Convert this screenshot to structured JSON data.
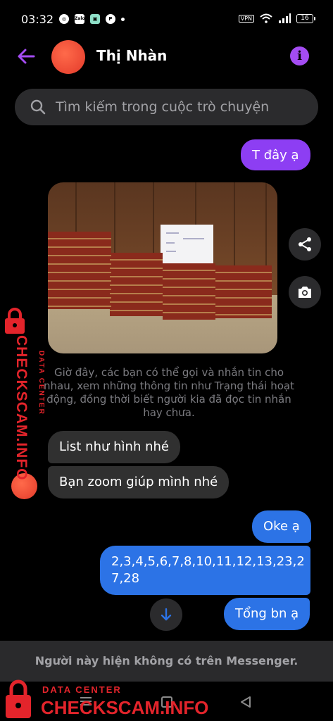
{
  "status": {
    "time": "03:32",
    "apps": [
      "chrome",
      "Zalo",
      "app",
      "pinterest"
    ],
    "vpn": "VPN",
    "battery": "16"
  },
  "header": {
    "contact_name": "Thị Nhàn",
    "info_symbol": "i"
  },
  "search": {
    "placeholder": "Tìm kiếm trong cuộc trò chuyện"
  },
  "messages": [
    {
      "side": "out",
      "text": "T đây ạ"
    },
    {
      "side": "in",
      "type": "photo"
    },
    {
      "side": "system",
      "text": "Giờ đây, các bạn có thể gọi và nhắn tin cho nhau, xem những thông tin như Trạng thái hoạt động, đồng thời biết người kia đã đọc tin nhắn hay chưa."
    },
    {
      "side": "in",
      "text": "List như hình nhé"
    },
    {
      "side": "in",
      "text": "Bạn zoom giúp mình nhé"
    },
    {
      "side": "out",
      "text": "Oke ạ"
    },
    {
      "side": "out",
      "text": "2,3,4,5,6,7,8,10,11,12,13,23,2\n7,28"
    },
    {
      "side": "out",
      "text": "Tổng bn ạ"
    }
  ],
  "footer": {
    "text": "Người này hiện không có trên Messenger."
  },
  "watermark": {
    "title": "CHECKSCAM.INFO",
    "subtitle": "DATA CENTER"
  },
  "colors": {
    "purple": "#8d3ef3",
    "blue": "#2c73e6",
    "incoming": "#303030",
    "watermark": "#e3242b"
  }
}
